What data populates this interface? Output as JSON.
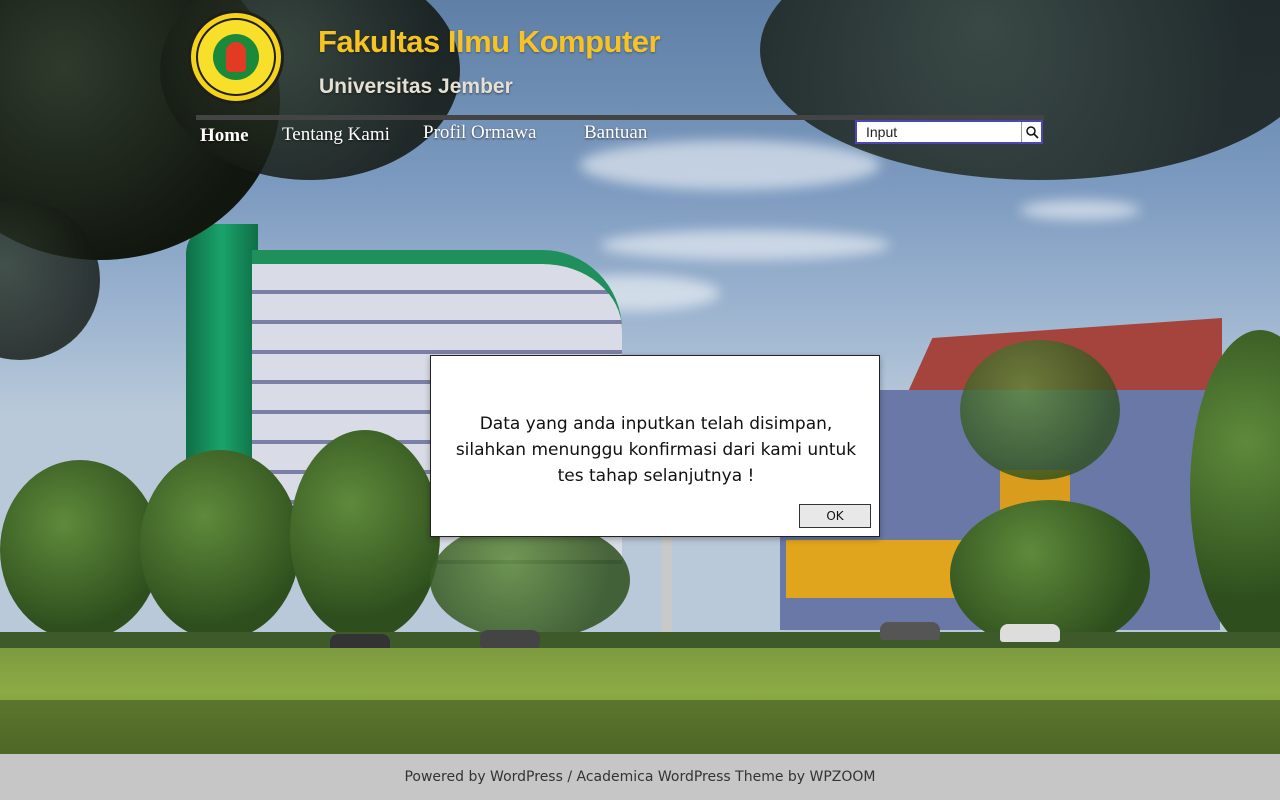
{
  "header": {
    "title": "Fakultas Ilmu Komputer",
    "subtitle": "Universitas Jember",
    "logo_icon": "university-seal-icon"
  },
  "nav": {
    "items": [
      {
        "label": "Home",
        "active": true
      },
      {
        "label": "Tentang Kami",
        "active": false
      },
      {
        "label": "Profil Ormawa",
        "active": false
      },
      {
        "label": "Bantuan",
        "active": false
      }
    ]
  },
  "search": {
    "placeholder": "Input",
    "icon": "search-icon"
  },
  "dialog": {
    "line1": "Data yang anda inputkan telah disimpan,",
    "line2": "silahkan menunggu konfirmasi dari kami untuk",
    "line3": "tes tahap selanjutnya !",
    "ok_label": "OK"
  },
  "footer": {
    "text": "Powered by WordPress / Academica WordPress Theme by WPZOOM"
  },
  "colors": {
    "title": "#f6c324",
    "footer_bg": "#c6c6c6",
    "search_border": "#4b45b8"
  }
}
